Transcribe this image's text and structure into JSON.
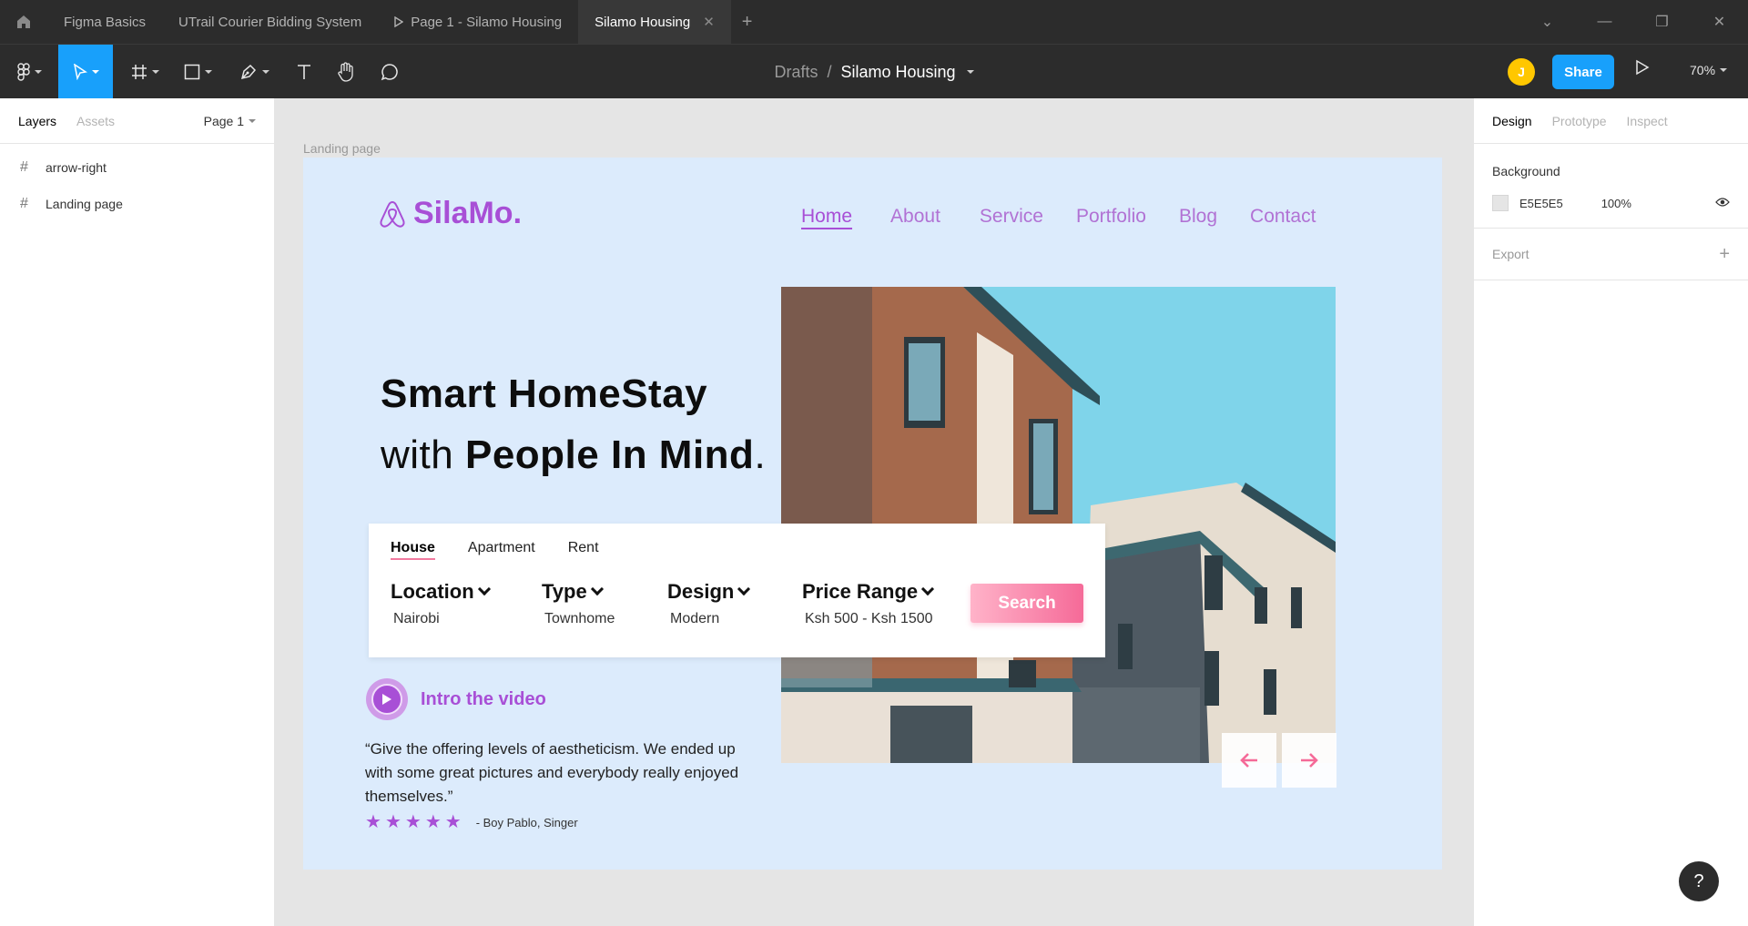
{
  "tabs": [
    {
      "label": "Figma Basics"
    },
    {
      "label": "UTrail Courier Bidding System"
    },
    {
      "label": "Page 1 - Silamo Housing"
    },
    {
      "label": "Silamo Housing"
    }
  ],
  "breadcrumb": {
    "parent": "Drafts",
    "separator": "/",
    "current": "Silamo Housing"
  },
  "toolbar": {
    "avatar_initial": "J",
    "share_label": "Share",
    "zoom": "70%"
  },
  "left_panel": {
    "tab_layers": "Layers",
    "tab_assets": "Assets",
    "page": "Page 1",
    "layers": [
      {
        "name": "arrow-right"
      },
      {
        "name": "Landing page"
      }
    ]
  },
  "right_panel": {
    "tab_design": "Design",
    "tab_prototype": "Prototype",
    "tab_inspect": "Inspect",
    "background_title": "Background",
    "bg_hex": "E5E5E5",
    "bg_opacity": "100%",
    "export_title": "Export"
  },
  "canvas": {
    "frame_label": "Landing page",
    "help": "?"
  },
  "landing": {
    "logo": "SilaMo.",
    "nav": [
      "Home",
      "About",
      "Service",
      "Portfolio",
      "Blog",
      "Contact"
    ],
    "headline_line1": "Smart HomeStay",
    "headline_with": "with ",
    "headline_bold": "People In Mind",
    "headline_dot": ".",
    "search_tabs": [
      "House",
      "Apartment",
      "Rent"
    ],
    "fields": [
      {
        "label": "Location",
        "value": "Nairobi"
      },
      {
        "label": "Type",
        "value": "Townhome"
      },
      {
        "label": "Design",
        "value": "Modern"
      },
      {
        "label": "Price Range",
        "value": "Ksh 500 - Ksh 1500"
      }
    ],
    "search_button": "Search",
    "video_label": "Intro the video",
    "quote": "“Give the offering levels of aestheticism. We ended up with some great pictures and everybody really enjoyed themselves.”",
    "rating": 5,
    "attribution": "- Boy Pablo, Singer"
  },
  "colors": {
    "figma_blue": "#18a0fb",
    "brand_purple": "#a84fd6",
    "frame_bg": "#dcebfc",
    "accent_pink": "#f56a98"
  }
}
